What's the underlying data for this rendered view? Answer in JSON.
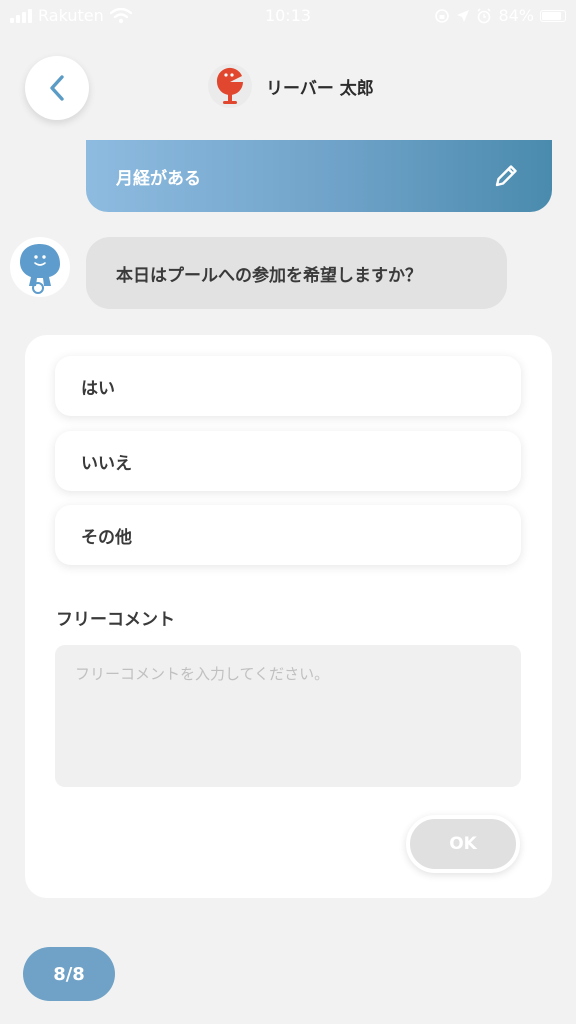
{
  "status_bar": {
    "carrier": "Rakuten",
    "time": "10:13",
    "battery": "84%"
  },
  "header": {
    "user_name": "リーバー 太郎",
    "back_icon": "chevron-left-icon"
  },
  "chat": {
    "answer_text": "月経がある",
    "edit_icon": "pencil-icon",
    "question_text": "本日はプールへの参加を希望しますか？"
  },
  "options": [
    {
      "label": "はい"
    },
    {
      "label": "いいえ"
    },
    {
      "label": "その他"
    }
  ],
  "comment": {
    "label": "フリーコメント",
    "placeholder": "フリーコメントを入力してください。",
    "value": ""
  },
  "ok_button": {
    "label": "OK"
  },
  "progress": {
    "label": "8/8"
  },
  "colors": {
    "accent": "#6fa2c6",
    "gradient_start": "#8ebbe0",
    "gradient_end": "#4a8bad",
    "question_bubble": "#e2e2e2",
    "background": "#f2f2f2"
  }
}
